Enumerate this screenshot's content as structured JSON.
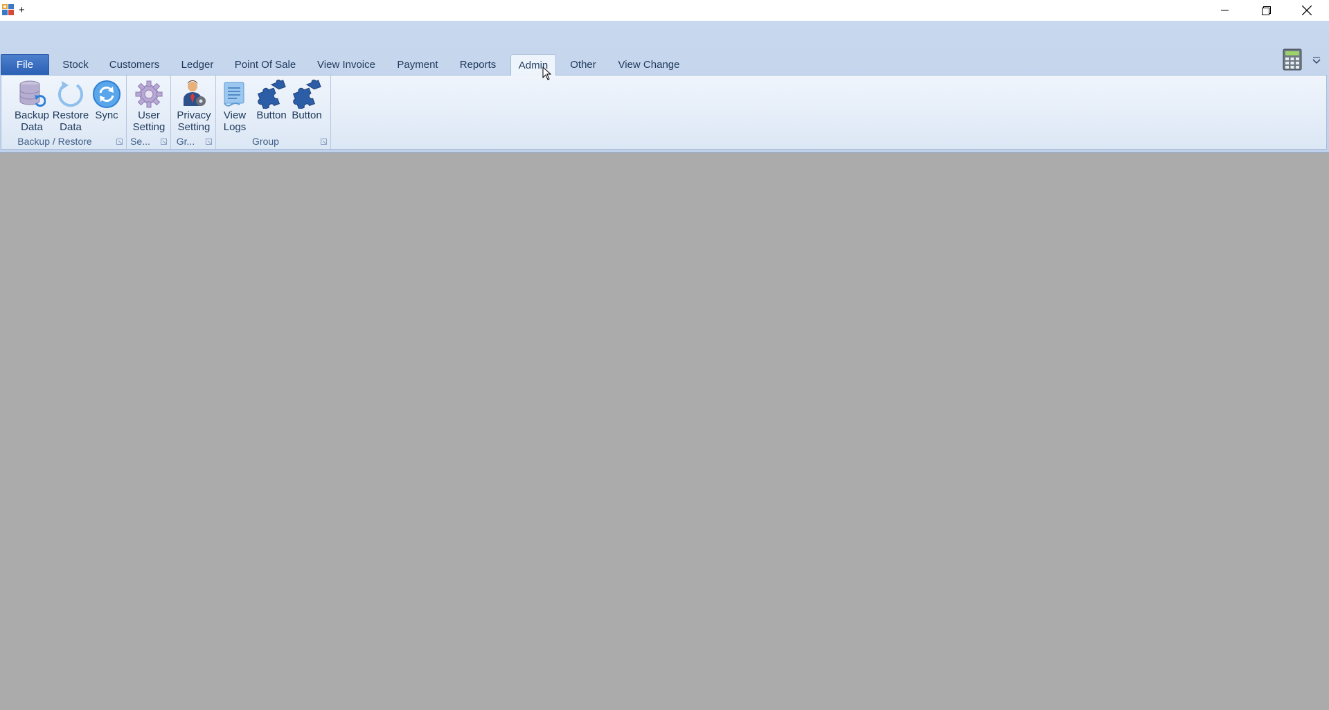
{
  "window": {
    "title": "+"
  },
  "tabs": [
    {
      "label": "File"
    },
    {
      "label": "Stock"
    },
    {
      "label": "Customers"
    },
    {
      "label": "Ledger"
    },
    {
      "label": "Point Of Sale"
    },
    {
      "label": "View Invoice"
    },
    {
      "label": "Payment"
    },
    {
      "label": "Reports"
    },
    {
      "label": "Admin"
    },
    {
      "label": "Other"
    },
    {
      "label": "View Change"
    }
  ],
  "active_tab": "Admin",
  "groups": [
    {
      "label": "Backup / Restore",
      "buttons": [
        {
          "label": "Backup\nData",
          "icon": "database-backup-icon"
        },
        {
          "label": "Restore\nData",
          "icon": "restore-icon"
        },
        {
          "label": "Sync",
          "icon": "sync-icon"
        }
      ]
    },
    {
      "label": "Se...",
      "buttons": [
        {
          "label": "User\nSetting",
          "icon": "gear-icon"
        }
      ]
    },
    {
      "label": "Gr...",
      "buttons": [
        {
          "label": "Privacy\nSetting",
          "icon": "user-settings-icon"
        }
      ]
    },
    {
      "label": "Group",
      "buttons": [
        {
          "label": "View\nLogs",
          "icon": "logs-icon"
        },
        {
          "label": "Button",
          "icon": "puzzle-icon"
        },
        {
          "label": "Button",
          "icon": "puzzle-icon"
        }
      ]
    }
  ],
  "colors": {
    "ribbon_bg": "#c8d8ee",
    "workspace_bg": "#ababab",
    "file_tab": "#2b5fb4"
  }
}
